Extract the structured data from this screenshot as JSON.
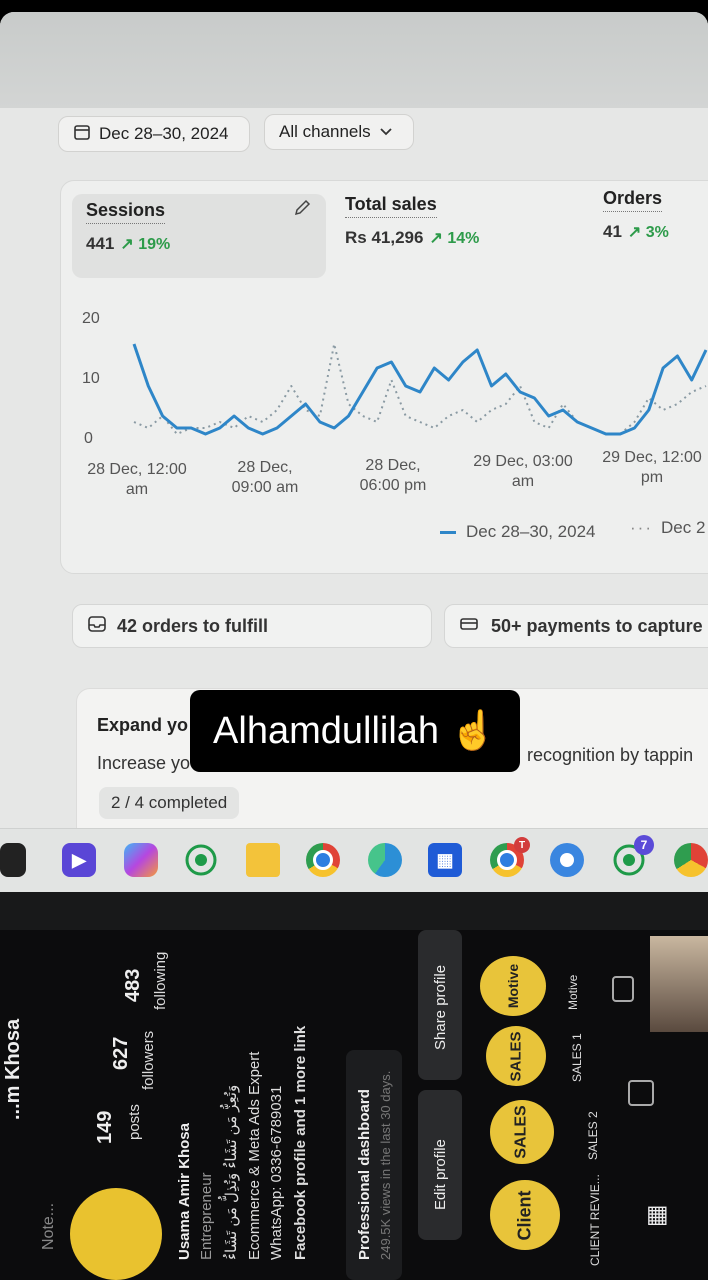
{
  "dashboard": {
    "date_range": "Dec 28–30, 2024",
    "channel_filter": "All channels",
    "metrics": [
      {
        "name": "Sessions",
        "value": "441",
        "delta": "19%"
      },
      {
        "name": "Total sales",
        "value": "Rs 41,296",
        "delta": "14%"
      },
      {
        "name": "Orders",
        "value": "41",
        "delta": "3%"
      }
    ],
    "legend_current": "Dec 28–30, 2024",
    "legend_previous": "Dec 2",
    "orders_to_fulfill": "42 orders to fulfill",
    "payments_to_capture": "50+ payments to capture",
    "expand_title": "Expand yo",
    "expand_body_left": "Increase yo",
    "expand_body_right": "recognition by tappin",
    "progress_label": "2 / 4 completed"
  },
  "chart_data": {
    "type": "line",
    "title": "",
    "ylabel": "",
    "xlabel": "",
    "ylim": [
      0,
      20
    ],
    "yticks": [
      "20",
      "10",
      "0"
    ],
    "xticks": [
      "28 Dec, 12:00 am",
      "28 Dec, 09:00 am",
      "28 Dec, 06:00 pm",
      "29 Dec, 03:00 am",
      "29 Dec, 12:00 pm"
    ],
    "series": [
      {
        "name": "Dec 28–30, 2024",
        "style": "solid",
        "color": "#2e86c8",
        "values": [
          16,
          9,
          4,
          2,
          2,
          1,
          2,
          4,
          2,
          1,
          2,
          4,
          6,
          3,
          2,
          4,
          8,
          12,
          13,
          9,
          8,
          12,
          10,
          13,
          15,
          9,
          11,
          8,
          7,
          4,
          5,
          3,
          2,
          1,
          1,
          2,
          5,
          12,
          14,
          10,
          15
        ]
      },
      {
        "name": "Dec 2",
        "style": "dotted",
        "color": "#8a9aa3",
        "values": [
          3,
          2,
          4,
          1,
          2,
          2,
          3,
          2,
          4,
          3,
          5,
          9,
          5,
          4,
          16,
          6,
          4,
          3,
          10,
          4,
          3,
          2,
          4,
          5,
          3,
          5,
          6,
          9,
          3,
          2,
          6,
          3,
          2,
          1,
          1,
          3,
          7,
          5,
          6,
          8,
          9
        ]
      }
    ],
    "grid": false,
    "legend_position": "bottom-right"
  },
  "overlay_caption": "Alhamdullilah ☝️",
  "taskbar": {
    "whatsapp_badge": "7",
    "chrome_badge": "T"
  },
  "phone": {
    "username": "...m Khosa",
    "posts_count": "149",
    "posts_label": "posts",
    "followers_count": "627",
    "followers_label": "followers",
    "following_count": "483",
    "following_label": "following",
    "display_name": "Usama Amir Khosa",
    "category": "Entrepreneur",
    "bio_arabic": "وَتُعِزُّ مَن تَشَاءُ وَتُذِلُّ مَن تَشَاءُ",
    "bio_line": "Ecommerce & Meta Ads Expert",
    "whatsapp": "WhatsApp: 0336-6789031",
    "links": "Facebook profile and 1 more link",
    "dashboard_title": "Professional dashboard",
    "dashboard_sub": "249.5K views in the last 30 days.",
    "edit_profile": "Edit profile",
    "share_profile": "Share profile",
    "note_label": "Note...",
    "highlights": [
      {
        "label": "CLIENT REVIE...",
        "badge": "Client"
      },
      {
        "label": "SALES 2",
        "badge": "SALES"
      },
      {
        "label": "SALES 1",
        "badge": "SALES"
      },
      {
        "label": "Motive",
        "badge": "Motive"
      }
    ]
  }
}
